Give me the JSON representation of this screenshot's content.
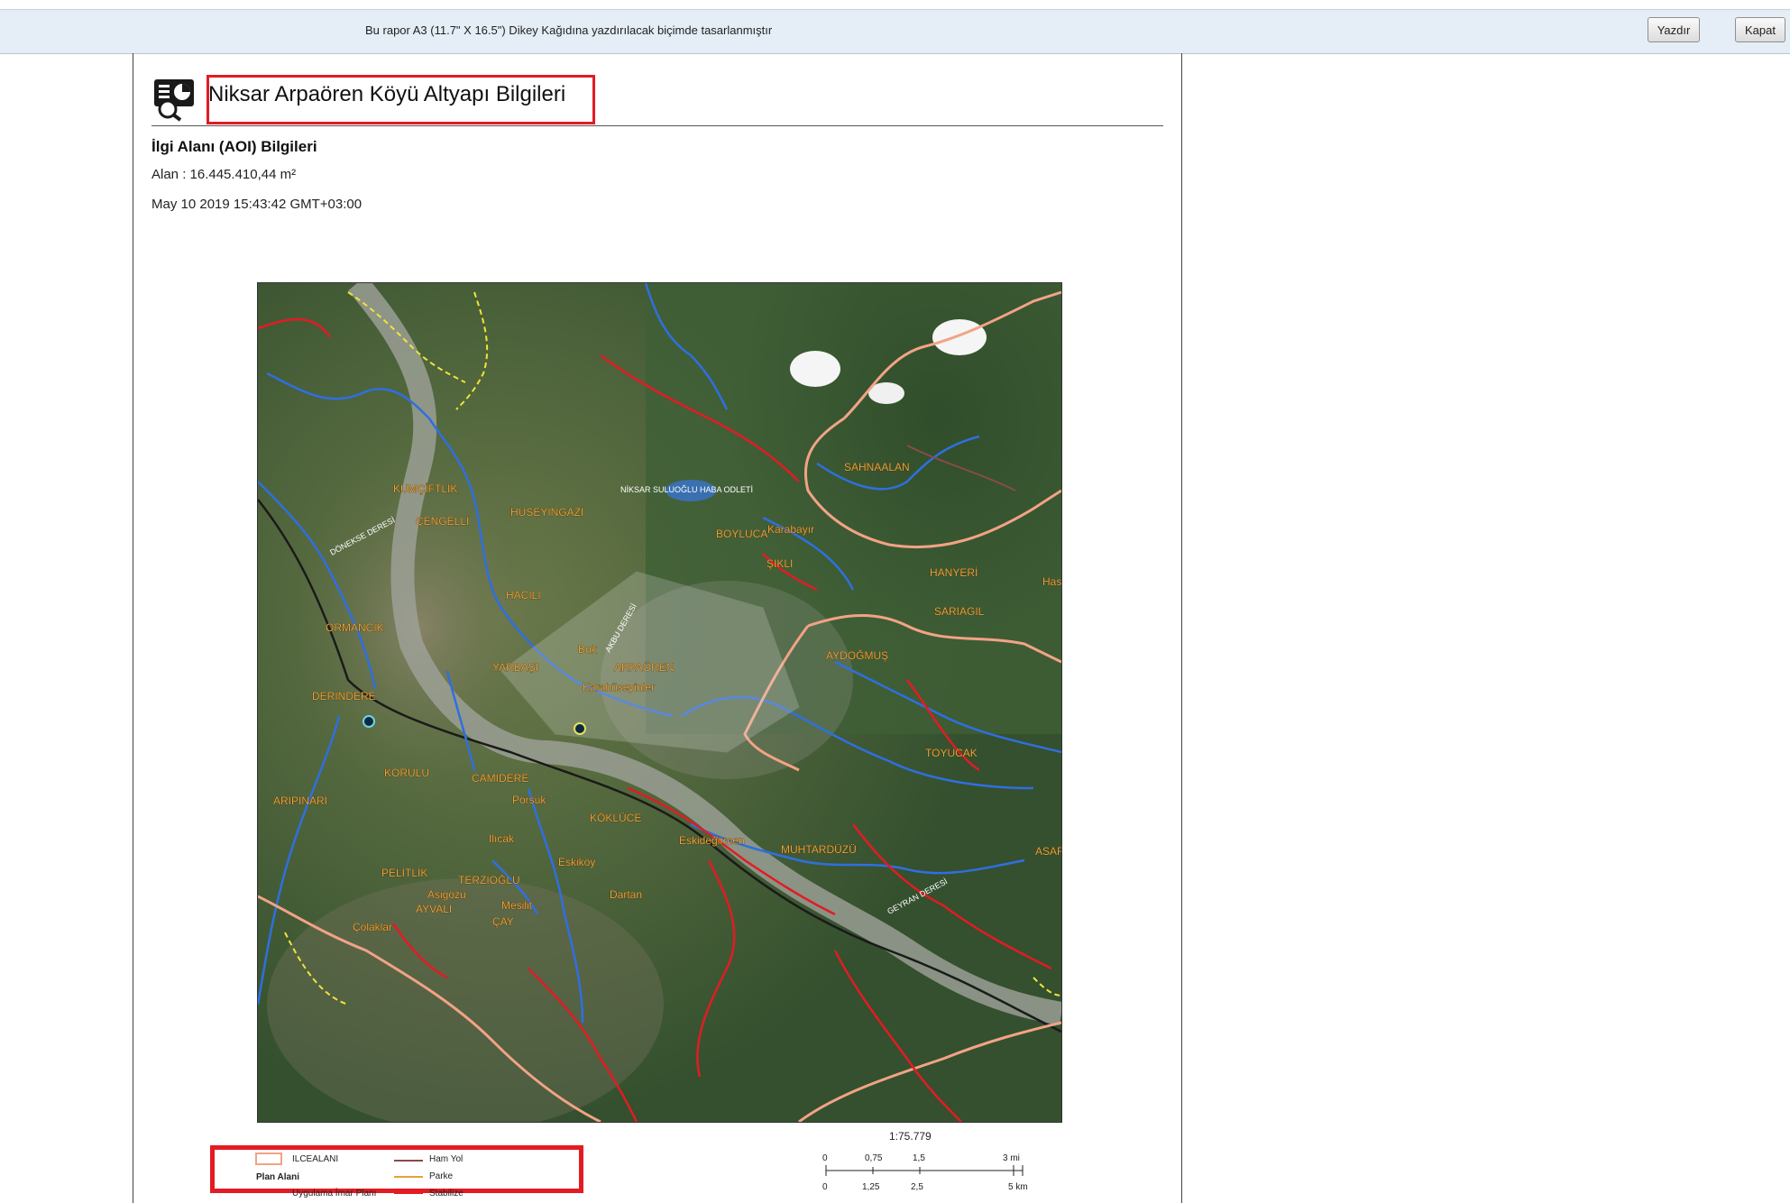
{
  "topbar": {
    "info": "Bu rapor A3 (11.7\" X 16.5\") Dikey Kağıdına yazdırılacak biçimde tasarlanmıştır",
    "print_label": "Yazdır",
    "close_label": "Kapat"
  },
  "report": {
    "title": "Niksar Arpaören Köyü Altyapı Bilgileri",
    "aoi_heading": "İlgi Alanı (AOI) Bilgileri",
    "area": "Alan : 16.445.410,44 m²",
    "timestamp": "May 10 2019 15:43:42 GMT+03:00"
  },
  "map": {
    "labels": [
      "KUMÇİFTLİK",
      "HÜSEYİNGAZİ",
      "ÇENGELLİ",
      "NİKSAR SULUOĞLU HABA ODLETİ",
      "BOYLUCA",
      "Karabayır",
      "ŞIKLI",
      "SAHNAALAN",
      "HANYERİ",
      "SARIAGIL",
      "HACILI",
      "ORMANCIK",
      "YARBAŞI",
      "Buk",
      "ARPAÖREN",
      "Karahüseyinler",
      "DERİNDERE",
      "AYDOĞMUŞ",
      "KORULU",
      "CAMİDERE",
      "Porsuk",
      "KÖKLÜCE",
      "TOYUCAK",
      "ARIPINARI",
      "Ilıcak",
      "Eskiköy",
      "Eskideğirmen",
      "MUHTARDÜZÜ",
      "PELİTLİK",
      "TERZİOĞLU",
      "Asigözü",
      "AYVALI",
      "Mesilit",
      "ÇAY",
      "Dartan",
      "Çolaklar",
      "ASAR",
      "Has",
      "DÖNEKSE DERESİ",
      "AKBU DERESİ",
      "GEYRAN DERESİ"
    ]
  },
  "legend": {
    "ilce": "ILCEALANI",
    "plan": "Plan Alani",
    "imar": "Uygulama İmar Planı",
    "ham": "Ham Yol",
    "parke": "Parke",
    "stabilize": "Stabilize"
  },
  "scale": {
    "ratio": "1:75.779",
    "mi": [
      "0",
      "0,75",
      "1,5",
      "3 mi"
    ],
    "km": [
      "0",
      "1,25",
      "2,5",
      "5 km"
    ]
  },
  "colors": {
    "border_red": "#e31b23",
    "district_boundary": "#f2a385",
    "river": "#2f6fe0",
    "stabilize_road": "#e31b23",
    "ham_road": "#8b4a4a",
    "parke_road": "#e8a23a",
    "imar_plan": "#f2e33a",
    "railway": "#1a1a1a"
  }
}
